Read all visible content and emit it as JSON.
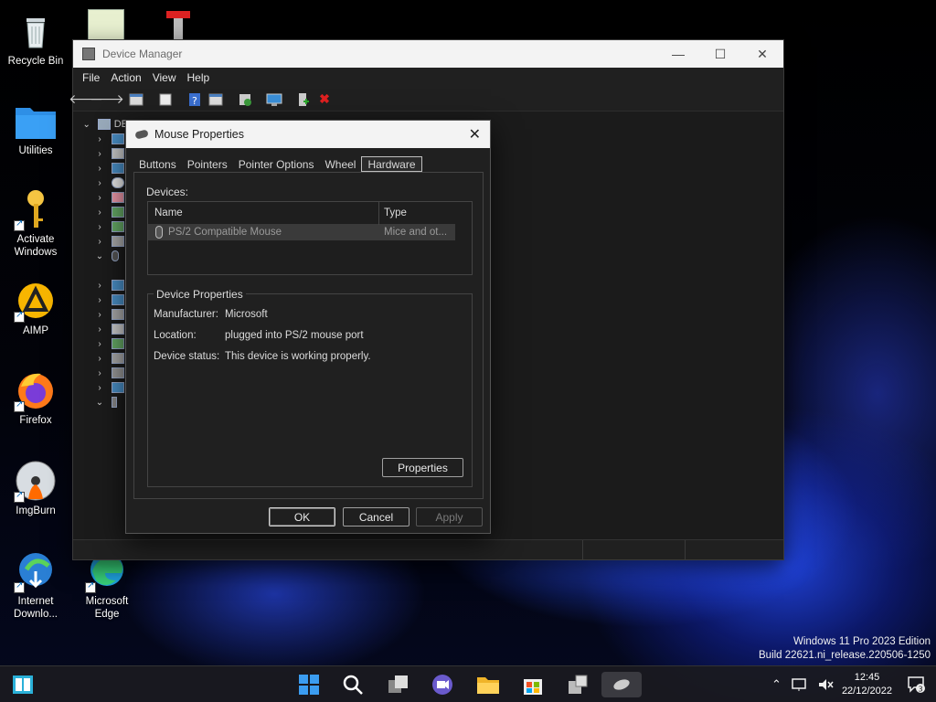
{
  "desktop": {
    "icons": [
      {
        "label": "Recycle Bin",
        "icon": "recycle-bin-icon"
      },
      {
        "label": "Utilities",
        "icon": "folder-icon"
      },
      {
        "label": "Activate Windows",
        "icon": "key-icon"
      },
      {
        "label": "AIMP",
        "icon": "aimp-icon"
      },
      {
        "label": "Firefox",
        "icon": "firefox-icon"
      },
      {
        "label": "ImgBurn",
        "icon": "imgburn-icon"
      },
      {
        "label": "Internet Downlo...",
        "icon": "idm-icon"
      },
      {
        "label": "Microsoft Edge",
        "icon": "edge-icon"
      }
    ]
  },
  "device_manager": {
    "title": "Device Manager",
    "menu": [
      "File",
      "Action",
      "View",
      "Help"
    ],
    "tree_root_prefix": "DE"
  },
  "mouse_props": {
    "title": "Mouse Properties",
    "tabs": [
      "Buttons",
      "Pointers",
      "Pointer Options",
      "Wheel",
      "Hardware"
    ],
    "active_tab": "Hardware",
    "devices_label": "Devices:",
    "columns": {
      "name": "Name",
      "type": "Type"
    },
    "device_row": {
      "name": "PS/2 Compatible Mouse",
      "type": "Mice and ot..."
    },
    "group_title": "Device Properties",
    "props": [
      {
        "key": "Manufacturer:",
        "value": "Microsoft"
      },
      {
        "key": "Location:",
        "value": "plugged into PS/2 mouse port"
      },
      {
        "key": "Device status:",
        "value": "This device is working properly."
      }
    ],
    "properties_button": "Properties",
    "ok": "OK",
    "cancel": "Cancel",
    "apply": "Apply"
  },
  "watermark": {
    "line1": "Windows 11 Pro 2023 Edition",
    "line2": "Build 22621.ni_release.220506-1250"
  },
  "taskbar": {
    "time": "12:45",
    "date": "22/12/2022",
    "notification_count": "3"
  }
}
